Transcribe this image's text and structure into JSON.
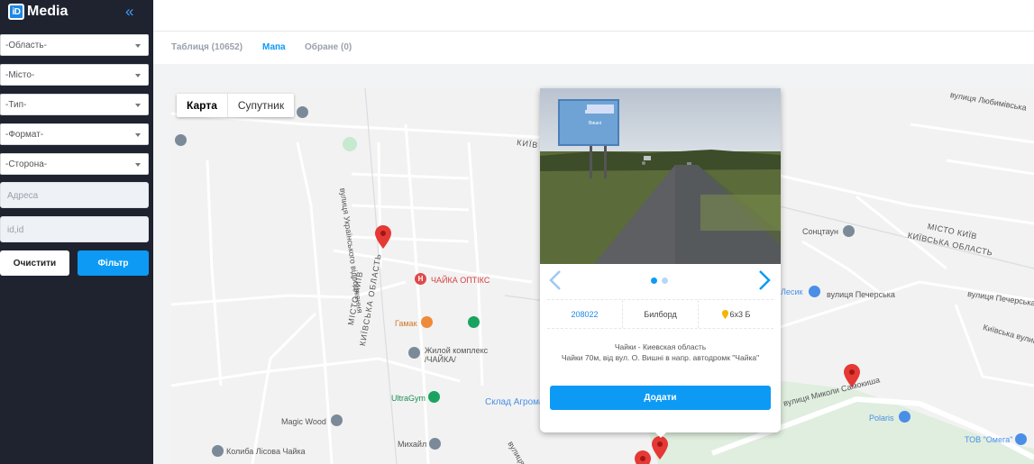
{
  "brand": {
    "logo_text": "iD",
    "name": "Media",
    "collapse_icon": "double-chevron-left-icon"
  },
  "filters": {
    "selects": [
      "-Область-",
      "-Місто-",
      "-Тип-",
      "-Формат-",
      "-Сторона-"
    ],
    "address_placeholder": "Адреса",
    "id_placeholder": "id,id",
    "clear_label": "Очистити",
    "filter_label": "Фільтр"
  },
  "tabs": [
    {
      "label": "Таблиця (10652)",
      "active": false
    },
    {
      "label": "Мапа",
      "active": true
    },
    {
      "label": "Обране (0)",
      "active": false
    }
  ],
  "map": {
    "type_buttons": [
      "Карта",
      "Супутник"
    ],
    "labels": {
      "l1": "вулиця Українського відродження",
      "l2": "МІСТО КИЇВ",
      "l3": "КИЇВСЬКА ОБЛАСТЬ",
      "l4": "ЧАЙКА ОПТІКС",
      "l5": "Гамак",
      "l6": "Жилой комплекс",
      "l7": "/ЧАЙКА/",
      "l8": "UltraGym",
      "l9": "Склад Агрома",
      "l10": "Magic Wood",
      "l11": "Михайл",
      "l12": "Колиба Лісова Чайка",
      "l13": "Сонцтаун",
      "l14": "МІСТО КИЇВ",
      "l15": "КИЇВСЬКА ОБЛАСТЬ",
      "l16": "Лесик",
      "l17": "вулиця Печерська",
      "l18": "вулиця Печерська",
      "l19": "Київська вулиця",
      "l20": "вулиця Миколи Самокиша",
      "l21": "Polaris",
      "l22": "ТОВ \"Омега\"",
      "l23": "вулиця Любимівська",
      "l24": "КИЇВ",
      "l25": "вулиця Гр"
    }
  },
  "popup": {
    "photo_alt": "billboard-photo",
    "id": "208022",
    "type": "Билборд",
    "size": "6x3 Б",
    "address_line1": "Чайки - Киевская область",
    "address_line2": "Чайки 70м, від вул. О. Вишні в напр. автодромк \"Чайка\"",
    "add_label": "Додати",
    "billboard_text": "СЛУХАЙТЕ САМИХ НАРОДНЕ",
    "billboard_text2": "Вишні"
  },
  "colors": {
    "accent": "#0d9af5",
    "sidebar": "#1f2330",
    "marker": "#e53935"
  }
}
